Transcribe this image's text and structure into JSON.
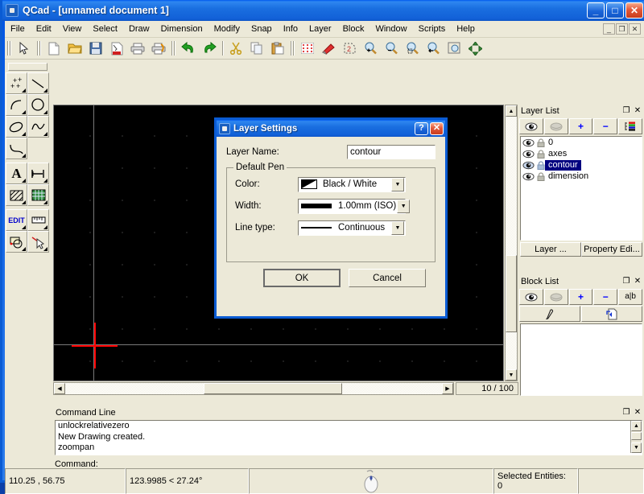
{
  "window": {
    "title": "QCad - [unnamed document 1]",
    "icon": "app-icon",
    "buttons": {
      "minimize": "_",
      "maximize": "□",
      "close": "✕"
    }
  },
  "menubar": {
    "items": [
      {
        "label": "File",
        "accel": "F"
      },
      {
        "label": "Edit",
        "accel": "E"
      },
      {
        "label": "View",
        "accel": "V"
      },
      {
        "label": "Select",
        "accel": "S"
      },
      {
        "label": "Draw",
        "accel": "D"
      },
      {
        "label": "Dimension",
        "accel": "D"
      },
      {
        "label": "Modify",
        "accel": "M"
      },
      {
        "label": "Snap",
        "accel": "S"
      },
      {
        "label": "Info",
        "accel": "I"
      },
      {
        "label": "Layer",
        "accel": "L"
      },
      {
        "label": "Block",
        "accel": "B"
      },
      {
        "label": "Window",
        "accel": "W"
      },
      {
        "label": "Scripts",
        "accel": "S"
      },
      {
        "label": "Help",
        "accel": "H"
      }
    ],
    "mdi_buttons": [
      "_",
      "❐",
      "✕"
    ]
  },
  "toolbar": {
    "groups": [
      [
        "select-pointer-icon"
      ],
      [
        "new-file-icon",
        "open-file-icon",
        "save-file-icon",
        "export-pdf-icon",
        "print-icon",
        "print-preview-icon"
      ],
      [
        "undo-icon",
        "redo-icon"
      ],
      [
        "cut-icon",
        "copy-icon",
        "paste-icon"
      ],
      [
        "grid-icon",
        "eraser-icon",
        "redraw-icon"
      ],
      [
        "zoom-in-icon",
        "zoom-out-icon",
        "zoom-auto-icon",
        "zoom-previous-icon",
        "zoom-window-icon",
        "pan-icon"
      ]
    ]
  },
  "left_palette": {
    "items": [
      {
        "name": "points-tool",
        "label": "points"
      },
      {
        "name": "line-tool",
        "label": "line"
      },
      {
        "name": "arc-tool",
        "label": "arc"
      },
      {
        "name": "circle-tool",
        "label": "circle"
      },
      {
        "name": "ellipse-tool",
        "label": "ellipse"
      },
      {
        "name": "spline-tool",
        "label": "spline"
      },
      {
        "name": "polyline-tool",
        "label": "polyline"
      },
      {
        "name": "text-tool",
        "label": "A"
      },
      {
        "name": "dimension-tool",
        "label": "dimension"
      },
      {
        "name": "hatch-tool",
        "label": "hatch"
      },
      {
        "name": "image-tool",
        "label": "image"
      },
      {
        "name": "edit-tool",
        "label": "EDIT"
      },
      {
        "name": "measure-tool",
        "label": "measure"
      },
      {
        "name": "modify-tool",
        "label": "modify"
      },
      {
        "name": "info-tool",
        "label": "info"
      }
    ]
  },
  "drawing": {
    "background": "#000000",
    "grid_color": "#9a9a9a",
    "axis_color": "#7a7a7a",
    "relative_zero_color": "#ff0000",
    "zoom_label": "10 / 100"
  },
  "layer_panel": {
    "title": "Layer List",
    "title_buttons": [
      "undock-icon",
      "close-icon"
    ],
    "toolbar": [
      {
        "name": "show-all-layers-button",
        "icon": "eye-open-icon",
        "label": ""
      },
      {
        "name": "hide-all-layers-button",
        "icon": "eye-closed-icon",
        "label": ""
      },
      {
        "name": "add-layer-button",
        "icon": "plus-icon",
        "label": "+"
      },
      {
        "name": "remove-layer-button",
        "icon": "minus-icon",
        "label": "−"
      },
      {
        "name": "edit-layer-button",
        "icon": "layer-edit-icon",
        "label": ""
      }
    ],
    "layers": [
      {
        "name": "0",
        "visible": true,
        "locked": false,
        "selected": false
      },
      {
        "name": "axes",
        "visible": true,
        "locked": false,
        "selected": false
      },
      {
        "name": "contour",
        "visible": true,
        "locked": false,
        "selected": true
      },
      {
        "name": "dimension",
        "visible": true,
        "locked": false,
        "selected": false
      }
    ],
    "tabs": [
      {
        "label": "Layer ...",
        "active": false
      },
      {
        "label": "Property Edi...",
        "active": true
      }
    ]
  },
  "block_panel": {
    "title": "Block List",
    "title_buttons": [
      "undock-icon",
      "close-icon"
    ],
    "toolbar_row1": [
      {
        "name": "show-all-blocks-button",
        "icon": "eye-open-icon",
        "label": ""
      },
      {
        "name": "hide-all-blocks-button",
        "icon": "eye-closed-icon",
        "label": ""
      },
      {
        "name": "add-block-button",
        "icon": "plus-icon",
        "label": "+"
      },
      {
        "name": "remove-block-button",
        "icon": "minus-icon",
        "label": "−"
      },
      {
        "name": "rename-block-button",
        "icon": "rename-icon",
        "label": "a|b"
      }
    ],
    "toolbar_row2": [
      {
        "name": "edit-block-button",
        "icon": "pencil-icon",
        "label": ""
      },
      {
        "name": "insert-block-button",
        "icon": "insert-block-icon",
        "label": ""
      }
    ],
    "blocks": []
  },
  "command_panel": {
    "title": "Command Line",
    "title_buttons": [
      "undock-icon",
      "close-icon"
    ],
    "history": [
      "unlockrelativezero",
      "New Drawing created.",
      "zoompan"
    ],
    "prompt": "Command:",
    "input_value": "",
    "input_placeholder": ""
  },
  "statusbar": {
    "absolute_coordinates": "110.25 , 56.75",
    "relative_coordinates": "123.9985 < 27.24°",
    "mouse_hint_icon": "mouse-icon",
    "selection_label": "Selected Entities:",
    "selection_count": "0"
  },
  "dialog": {
    "title": "Layer Settings",
    "icon": "app-icon",
    "help_button": "?",
    "close_button": "✕",
    "layer_name_label": "Layer Name:",
    "layer_name_value": "contour",
    "layer_name_placeholder": "",
    "group_title": "Default Pen",
    "fields": [
      {
        "label": "Color:",
        "value": "Black / White",
        "swatch": "color-swatch"
      },
      {
        "label": "Width:",
        "value": "1.00mm (ISO)",
        "swatch": "width-swatch"
      },
      {
        "label": "Line type:",
        "value": "Continuous",
        "swatch": "linetype-swatch"
      }
    ],
    "ok_label": "OK",
    "cancel_label": "Cancel"
  },
  "colors": {
    "titlebar_blue": "#0a5bd3",
    "face": "#ece9d8",
    "selection_blue": "#000080",
    "accent_blue": "#0000ff",
    "canvas_black": "#000000",
    "relative_zero_red": "#ff0000"
  }
}
